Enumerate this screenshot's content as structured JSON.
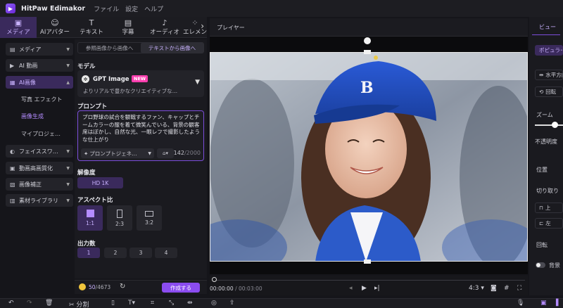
{
  "app": {
    "name": "HitPaw Edimakor",
    "menus": [
      "ファイル",
      "設定",
      "ヘルプ"
    ]
  },
  "category_tabs": [
    {
      "label": "メディア",
      "icon": "media-icon",
      "glyph": "▣"
    },
    {
      "label": "AIアバター",
      "icon": "avatar-icon",
      "glyph": "☺"
    },
    {
      "label": "テキスト",
      "icon": "text-icon",
      "glyph": "T"
    },
    {
      "label": "字幕",
      "icon": "subtitle-icon",
      "glyph": "▤"
    },
    {
      "label": "オーディオ",
      "icon": "audio-icon",
      "glyph": "♪"
    },
    {
      "label": "エレメン",
      "icon": "element-icon",
      "glyph": "⁘"
    }
  ],
  "sidebar": {
    "items": [
      {
        "label": "メディア",
        "glyph": "▤"
      },
      {
        "label": "AI 動画",
        "glyph": "▶"
      },
      {
        "label": "AI画像",
        "glyph": "▦"
      },
      {
        "label": "フェイススワ…",
        "glyph": "◐"
      },
      {
        "label": "動画高画質化",
        "glyph": "▣"
      },
      {
        "label": "画像補正",
        "glyph": "▧"
      },
      {
        "label": "素材ライブラリ",
        "glyph": "▥"
      }
    ],
    "subitems": [
      "写真 エフェクト",
      "画像生成",
      "マイプロジェ…"
    ]
  },
  "panel": {
    "mode_tabs": [
      "参照画像から画像へ",
      "テキストから画像へ"
    ],
    "model_label": "モデル",
    "model_name": "GPT Image 2",
    "model_badge": "NEW",
    "model_desc": "よりリアルで豊かなクリエイティブな…",
    "prompt_label": "プロンプト",
    "prompt_text": "プロ野球の試合を観戦するファン、キャップとチームカラーの服を着て微笑んでいる、背景の観客席はぼかし、自然な光、一眼レフで撮影したような仕上がり",
    "prompt_generator": "プロンプトジェネ…",
    "prompt_count": "142",
    "prompt_max": "/2000",
    "resolution_label": "解像度",
    "resolution_value": "HD 1K",
    "aspect_label": "アスペクト比",
    "aspect_ratios": [
      "1:1",
      "2:3",
      "3:2"
    ],
    "output_label": "出力数",
    "output_counts": [
      "1",
      "2",
      "3",
      "4"
    ],
    "credits_used": "50",
    "credits_total": "/4673",
    "create_label": "作成する"
  },
  "player": {
    "title": "プレイヤー",
    "time_current": "00:00:00",
    "time_total": "/ 00:03:00",
    "ratio": "4:3"
  },
  "right_panel": {
    "tab": "ビュー",
    "style_btn": "ポピュラー",
    "flip_btn": "水平方向",
    "rotate_btn": "回転",
    "zoom_label": "ズーム",
    "opacity_label": "不透明度",
    "position_label": "位置",
    "crop_label": "切り取り",
    "top_btn": "上",
    "left_btn": "左",
    "rotation_label": "回転",
    "background_label": "背景"
  },
  "toolbar": {
    "split_label": "分割"
  },
  "colors": {
    "accent": "#8b4cf0",
    "accent_text": "#c9b2ff",
    "badge": "#ff3fb0",
    "cap_blue": "#1f4fc4"
  }
}
